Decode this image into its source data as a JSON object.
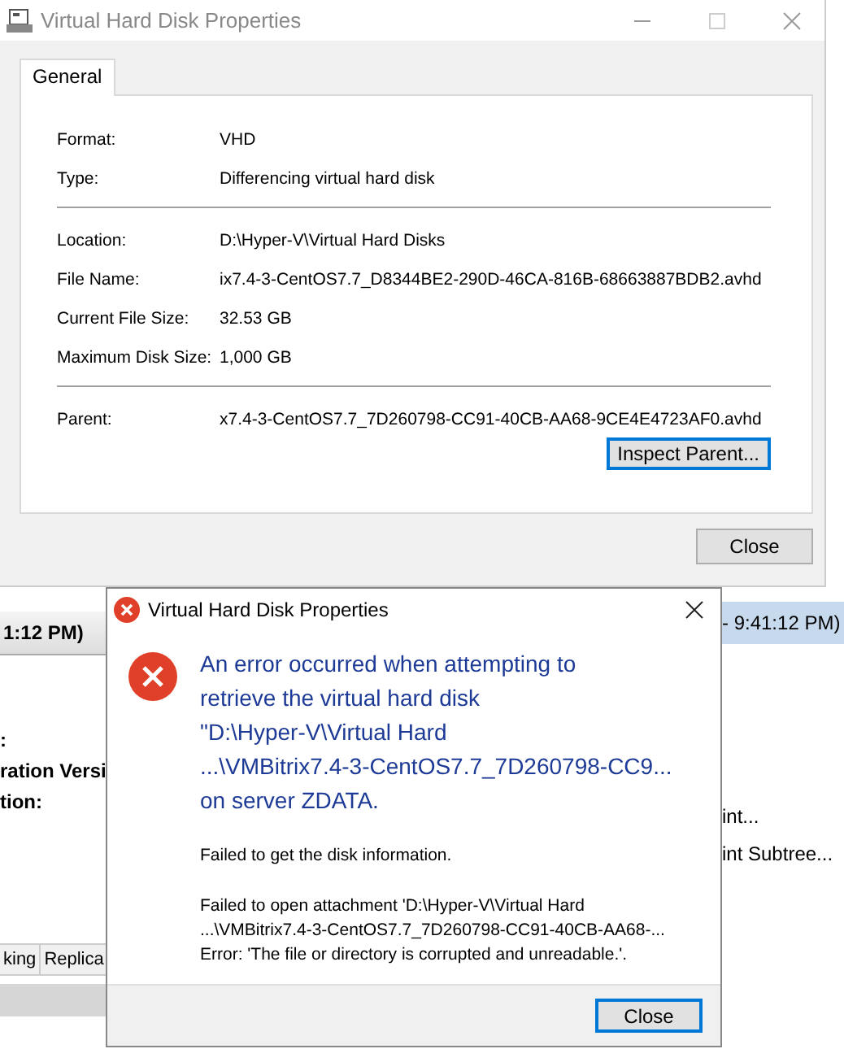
{
  "background_window": {
    "left_header": "1:12 PM)",
    "left_labels": [
      ":",
      "ration Versi",
      "tion:"
    ],
    "tabs": [
      {
        "label": "king",
        "selected": false
      },
      {
        "label": "Replica",
        "selected": false
      }
    ],
    "right_header": "- 9:41:12 PM)",
    "right_actions": [
      "int...",
      "int Subtree..."
    ]
  },
  "properties_window": {
    "title": "Virtual Hard Disk Properties",
    "tabs": [
      {
        "label": "General",
        "selected": true
      }
    ],
    "groups": [
      [
        {
          "label": "Format:",
          "value": "VHD"
        },
        {
          "label": "Type:",
          "value": "Differencing virtual hard disk"
        }
      ],
      [
        {
          "label": "Location:",
          "value": "D:\\Hyper-V\\Virtual Hard Disks"
        },
        {
          "label": "File Name:",
          "value": "ix7.4-3-CentOS7.7_D8344BE2-290D-46CA-816B-68663887BDB2.avhd"
        },
        {
          "label": "Current File Size:",
          "value": "32.53 GB"
        },
        {
          "label": "Maximum Disk Size:",
          "value": "1,000 GB"
        }
      ],
      [
        {
          "label": "Parent:",
          "value": "x7.4-3-CentOS7.7_7D260798-CC91-40CB-AA68-9CE4E4723AF0.avhd"
        }
      ]
    ],
    "inspect_button": "Inspect Parent...",
    "close_button": "Close"
  },
  "error_dialog": {
    "title": "Virtual Hard Disk Properties",
    "main_instruction": "An error occurred when attempting to\nretrieve the virtual hard disk\n\"D:\\Hyper-V\\Virtual Hard\n...\\VMBitrix7.4-3-CentOS7.7_7D260798-CC9...\non server ZDATA.",
    "messages": [
      "Failed to get the disk information.",
      "Failed to open attachment 'D:\\Hyper-V\\Virtual Hard\n...\\VMBitrix7.4-3-CentOS7.7_7D260798-CC91-40CB-AA68-...\nError: 'The file or directory is corrupted and unreadable.'."
    ],
    "close_button": "Close"
  }
}
